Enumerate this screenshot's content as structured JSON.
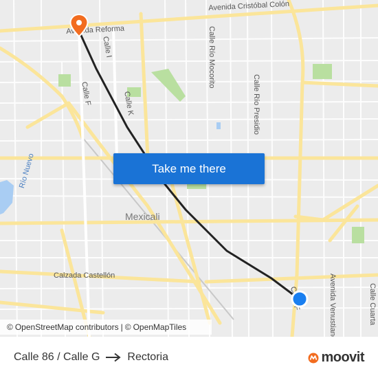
{
  "map": {
    "streets": {
      "avenida_cristobal_colon": "Avenida Cristóbal Colón",
      "avenida_reforma": "Avenida Reforma",
      "calle_i": "Calle I",
      "calle_f_north": "Calle F",
      "calle_k": "Calle K",
      "calle_rio_mocorito": "Calle Río Mocorito",
      "calle_rio_presidio": "Calle Río Presidio",
      "rio_nuevo": "Río Nuevo",
      "calzada_castellon": "Calzada Castellón",
      "calle_f_south": "Calle F",
      "avenida_venustiano": "Avenida Venustiano",
      "calle_cuarta": "Calle Cuarta"
    },
    "city": "Mexicali",
    "colors": {
      "route": "#222222",
      "destination_pin": "#f26c1f",
      "origin_dot": "#1a7ff0",
      "major_road": "#fbe59a",
      "park": "#b9dfa0",
      "water": "#a9cdf3"
    },
    "icons": {
      "destination": "destination-pin-icon",
      "origin": "origin-dot-icon"
    }
  },
  "cta": {
    "label": "Take me there"
  },
  "attribution": {
    "symbol1": "©",
    "osm": "OpenStreetMap contributors",
    "separator": "|",
    "symbol2": "©",
    "omt": "OpenMapTiles"
  },
  "footer": {
    "from": "Calle 86 / Calle G",
    "to": "Rectoria",
    "arrow_icon": "arrow-right-icon"
  },
  "brand": {
    "name": "moovit",
    "logo_icon": "moovit-logo-icon"
  }
}
